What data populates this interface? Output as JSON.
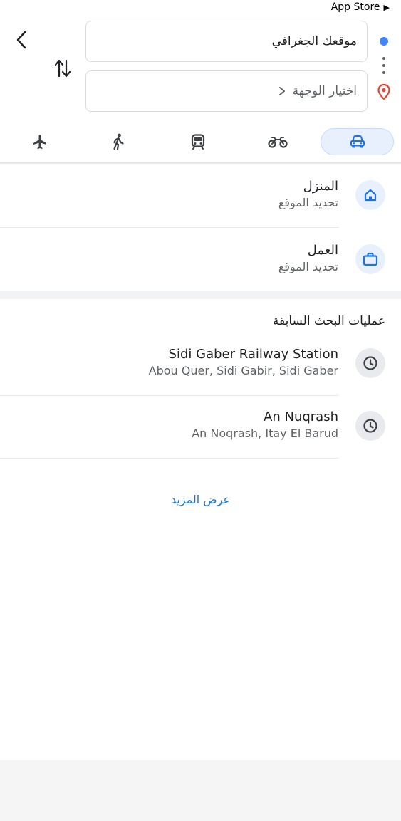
{
  "status_bar": {
    "back_app": "App Store"
  },
  "directions": {
    "origin": {
      "value": "موقعك الجغرافي"
    },
    "destination": {
      "placeholder": "اختيار الوجهة"
    }
  },
  "travel_modes": [
    {
      "icon": "car-icon",
      "active": true
    },
    {
      "icon": "motorcycle-icon",
      "active": false
    },
    {
      "icon": "train-icon",
      "active": false
    },
    {
      "icon": "walking-icon",
      "active": false
    },
    {
      "icon": "flight-icon",
      "active": false
    }
  ],
  "saved_places": [
    {
      "title": "المنزل",
      "subtitle": "تحديد الموقع",
      "icon": "home-icon"
    },
    {
      "title": "العمل",
      "subtitle": "تحديد الموقع",
      "icon": "work-icon"
    }
  ],
  "recent": {
    "heading": "عمليات البحث السابقة",
    "items": [
      {
        "title": "Sidi Gaber Railway Station",
        "subtitle": "Abou Quer, Sidi Gabir, Sidi Gaber",
        "icon": "clock-icon"
      },
      {
        "title": "An Nuqrash",
        "subtitle": "An Noqrash, Itay El Barud",
        "icon": "clock-icon"
      }
    ],
    "more_label": "عرض المزيد"
  },
  "colors": {
    "accent": "#1a73e8",
    "origin_dot": "#4285f4",
    "pin": "#ea4335",
    "active_mode_bg": "#e8f0fe"
  }
}
